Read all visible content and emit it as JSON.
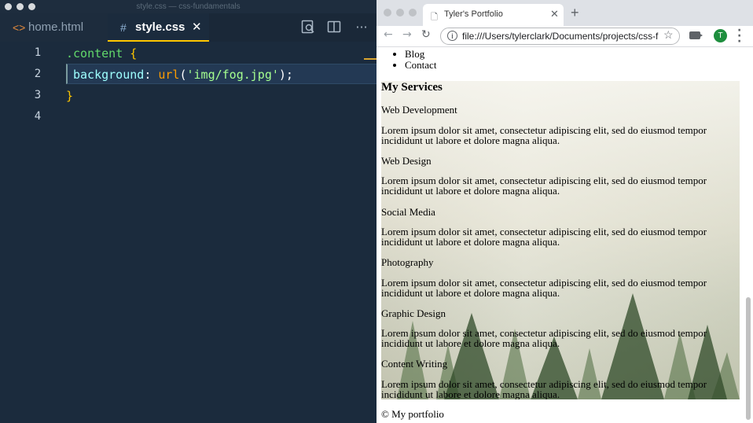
{
  "editor": {
    "window_title": "style.css — css-fundamentals",
    "tabs": [
      {
        "label": "home.html",
        "icon": "html-code-icon"
      },
      {
        "label": "style.css",
        "icon": "hash-icon"
      }
    ],
    "line_numbers": [
      "1",
      "2",
      "3",
      "4"
    ],
    "code": {
      "selector": ".content",
      "open_brace": "{",
      "property": "background",
      "colon": ":",
      "fn_name": "url",
      "paren_open": "(",
      "string": "'img/fog.jpg'",
      "paren_close": ");",
      "close_brace": "}"
    },
    "colors": {
      "background": "#1b2b3d",
      "accent": "#ffc600"
    }
  },
  "browser": {
    "tab_title": "Tyler's Portfolio",
    "url": "file:///Users/tylerclark/Documents/projects/css-fu...",
    "avatar_initial": "T",
    "page": {
      "nav_items": [
        "Blog",
        "Contact"
      ],
      "services_heading": "My Services",
      "services": [
        {
          "name": "Web Development",
          "text": "Lorem ipsum dolor sit amet, consectetur adipiscing elit, sed do eiusmod tempor incididunt ut labore et dolore magna aliqua."
        },
        {
          "name": "Web Design",
          "text": "Lorem ipsum dolor sit amet, consectetur adipiscing elit, sed do eiusmod tempor incididunt ut labore et dolore magna aliqua."
        },
        {
          "name": "Social Media",
          "text": "Lorem ipsum dolor sit amet, consectetur adipiscing elit, sed do eiusmod tempor incididunt ut labore et dolore magna aliqua."
        },
        {
          "name": "Photography",
          "text": "Lorem ipsum dolor sit amet, consectetur adipiscing elit, sed do eiusmod tempor incididunt ut labore et dolore magna aliqua."
        },
        {
          "name": "Graphic Design",
          "text": "Lorem ipsum dolor sit amet, consectetur adipiscing elit, sed do eiusmod tempor incididunt ut labore et dolore magna aliqua."
        },
        {
          "name": "Content Writing",
          "text": "Lorem ipsum dolor sit amet, consectetur adipiscing elit, sed do eiusmod tempor incididunt ut labore et dolore magna aliqua."
        }
      ],
      "footer": "© My portfolio"
    }
  }
}
